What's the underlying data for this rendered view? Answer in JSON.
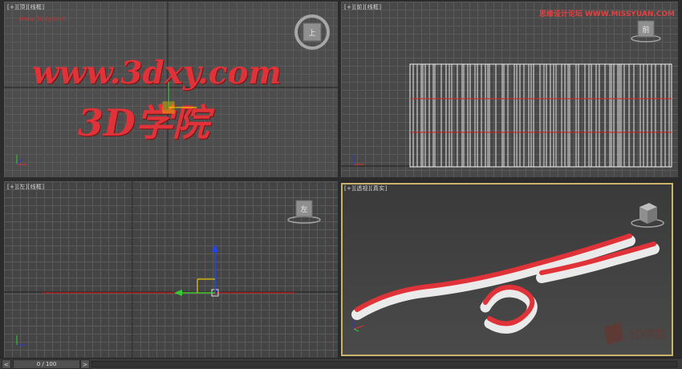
{
  "viewports": {
    "top": {
      "label": "[+][顶][线框]",
      "url_text": "www.3dxy.com",
      "cn_text": "3D学院",
      "small_text": "www.3dxy.com",
      "cube_label": "上"
    },
    "front": {
      "label": "[+][前][线框]",
      "cube_label": "前"
    },
    "left": {
      "label": "[+][左][线框]",
      "cube_label": "左"
    },
    "perspective": {
      "label": "[+][透视][真实]",
      "logo_text": "3D学院"
    }
  },
  "site_watermark": "思缘设计论坛 WWW.MISSYUAN.COM",
  "timeline": {
    "counter": "0 / 100",
    "prev": "<",
    "next": ">"
  },
  "colors": {
    "active_border": "#c8b46a",
    "text_red": "#e03339",
    "grid": "#5a5a5a"
  }
}
